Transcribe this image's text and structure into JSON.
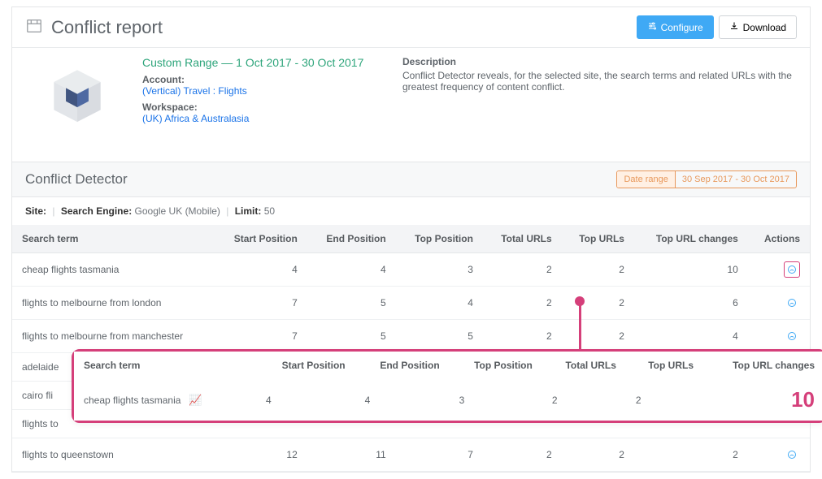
{
  "header": {
    "title": "Conflict report",
    "configure": "Configure",
    "download": "Download"
  },
  "meta": {
    "range": "Custom Range — 1 Oct 2017 - 30 Oct 2017",
    "account_label": "Account:",
    "account": "(Vertical) Travel : Flights",
    "workspace_label": "Workspace:",
    "workspace": "(UK) Africa & Australasia",
    "desc_label": "Description",
    "desc": "Conflict Detector reveals, for the selected site, the search terms and related URLs with the greatest frequency of content conflict."
  },
  "panel": {
    "title": "Conflict Detector",
    "chip_label": "Date range",
    "chip_value": "30 Sep 2017 - 30 Oct 2017"
  },
  "filters": {
    "site_label": "Site:",
    "engine_label": "Search Engine:",
    "engine": "Google UK (Mobile)",
    "limit_label": "Limit:",
    "limit": "50"
  },
  "columns": {
    "term": "Search term",
    "start": "Start Position",
    "end": "End Position",
    "top": "Top Position",
    "total_urls": "Total URLs",
    "top_urls": "Top URLs",
    "changes": "Top URL changes",
    "actions": "Actions"
  },
  "rows": [
    {
      "term": "cheap flights tasmania",
      "start": "4",
      "end": "4",
      "top": "3",
      "total": "2",
      "topu": "2",
      "chg": "10",
      "hl": true
    },
    {
      "term": "flights to melbourne from london",
      "start": "7",
      "end": "5",
      "top": "4",
      "total": "2",
      "topu": "2",
      "chg": "6"
    },
    {
      "term": "flights to melbourne from manchester",
      "start": "7",
      "end": "5",
      "top": "5",
      "total": "2",
      "topu": "2",
      "chg": "4"
    },
    {
      "term": "adelaide",
      "start": "",
      "end": "",
      "top": "",
      "total": "",
      "topu": "",
      "chg": ""
    },
    {
      "term": "cairo fli",
      "start": "",
      "end": "",
      "top": "",
      "total": "",
      "topu": "",
      "chg": ""
    },
    {
      "term": "flights to",
      "start": "",
      "end": "",
      "top": "",
      "total": "",
      "topu": "",
      "chg": ""
    },
    {
      "term": "flights to queenstown",
      "start": "12",
      "end": "11",
      "top": "7",
      "total": "2",
      "topu": "2",
      "chg": "2"
    }
  ],
  "callout": {
    "term": "cheap flights tasmania",
    "start": "4",
    "end": "4",
    "top": "3",
    "total": "2",
    "topu": "2",
    "chg": "10"
  }
}
